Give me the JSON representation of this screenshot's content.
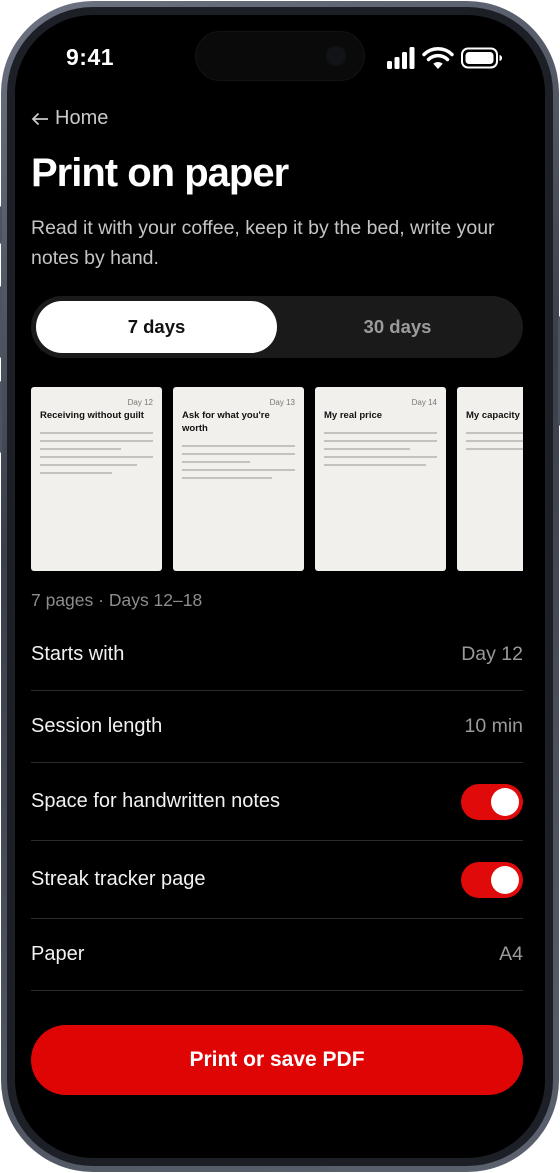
{
  "status": {
    "time": "9:41"
  },
  "nav": {
    "back_label": "Home"
  },
  "header": {
    "title": "Print on paper",
    "subtitle": "Read it with your coffee, keep it by the bed, write your notes by hand."
  },
  "segment": {
    "options": [
      "7 days",
      "30 days"
    ],
    "selected": "7 days"
  },
  "pages": [
    {
      "day": "Day 12",
      "title": "Receiving without guilt"
    },
    {
      "day": "Day 13",
      "title": "Ask for what you're worth"
    },
    {
      "day": "Day 14",
      "title": "My real price"
    },
    {
      "day": "",
      "title": "My capacity"
    }
  ],
  "pages_info": "7 pages · Days 12–18",
  "settings": {
    "starts_with": {
      "label": "Starts with",
      "value": "Day 12"
    },
    "session_length": {
      "label": "Session length",
      "value": "10 min"
    },
    "handwritten_notes": {
      "label": "Space for handwritten notes",
      "enabled": true
    },
    "streak_tracker": {
      "label": "Streak tracker page",
      "enabled": true
    },
    "paper": {
      "label": "Paper",
      "value": "A4"
    }
  },
  "cta": {
    "label": "Print or save PDF"
  },
  "colors": {
    "accent": "#E00505",
    "background": "#000000",
    "page": "#F1F0EC"
  }
}
